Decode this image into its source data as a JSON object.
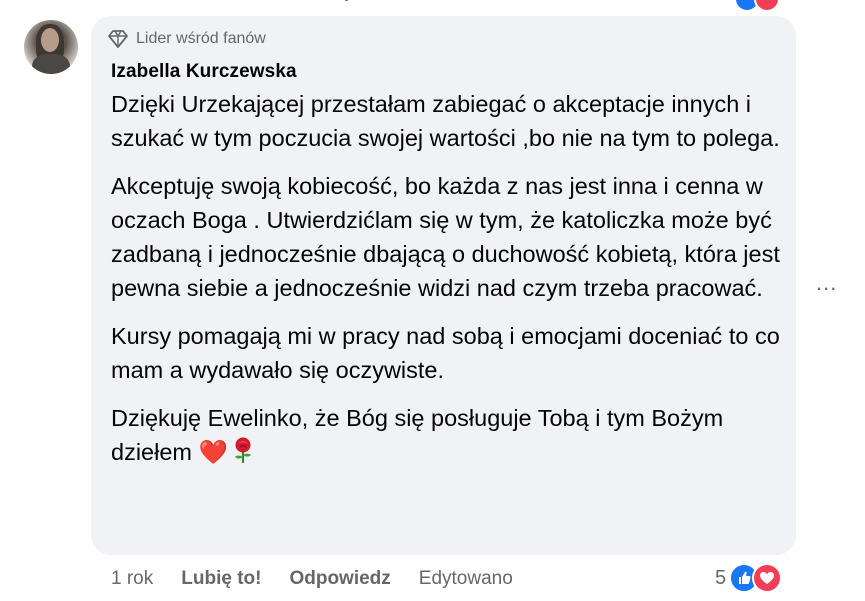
{
  "comment": {
    "badge": "Lider wśród fanów",
    "author": "Izabella Kurczewska",
    "paragraphs": [
      "Dzięki Urzekającej przestałam zabiegać o akceptacje innych i szukać w tym poczucia swojej wartości ,bo nie na tym to polega.",
      "Akceptuję swoją kobiecość, bo każda z nas jest inna i cenna w oczach Boga . Utwierdzićlam się w tym, że katoliczka może być zadbaną i jednocześnie dbającą o duchowość kobietą, która jest pewna siebie a jednocześnie widzi nad czym trzeba pracować.",
      "Kursy pomagają mi w pracy nad sobą i emocjami doceniać to co mam a wydawało się oczywiste.",
      "Dziękuję Ewelinko, że Bóg się posługuje Tobą i tym Bożym dziełem"
    ],
    "emoji_heart": "❤️",
    "emoji_rose_icon": "rose-icon"
  },
  "actions": {
    "time": "1 rok",
    "like": "Lubię to!",
    "reply": "Odpowiedz",
    "edited": "Edytowano"
  },
  "reactions": {
    "count": "5",
    "icons": [
      "like-icon",
      "love-icon"
    ],
    "like_color": "#1877f2",
    "love_color": "#f33e58"
  },
  "menu": {
    "more_label": "..."
  }
}
